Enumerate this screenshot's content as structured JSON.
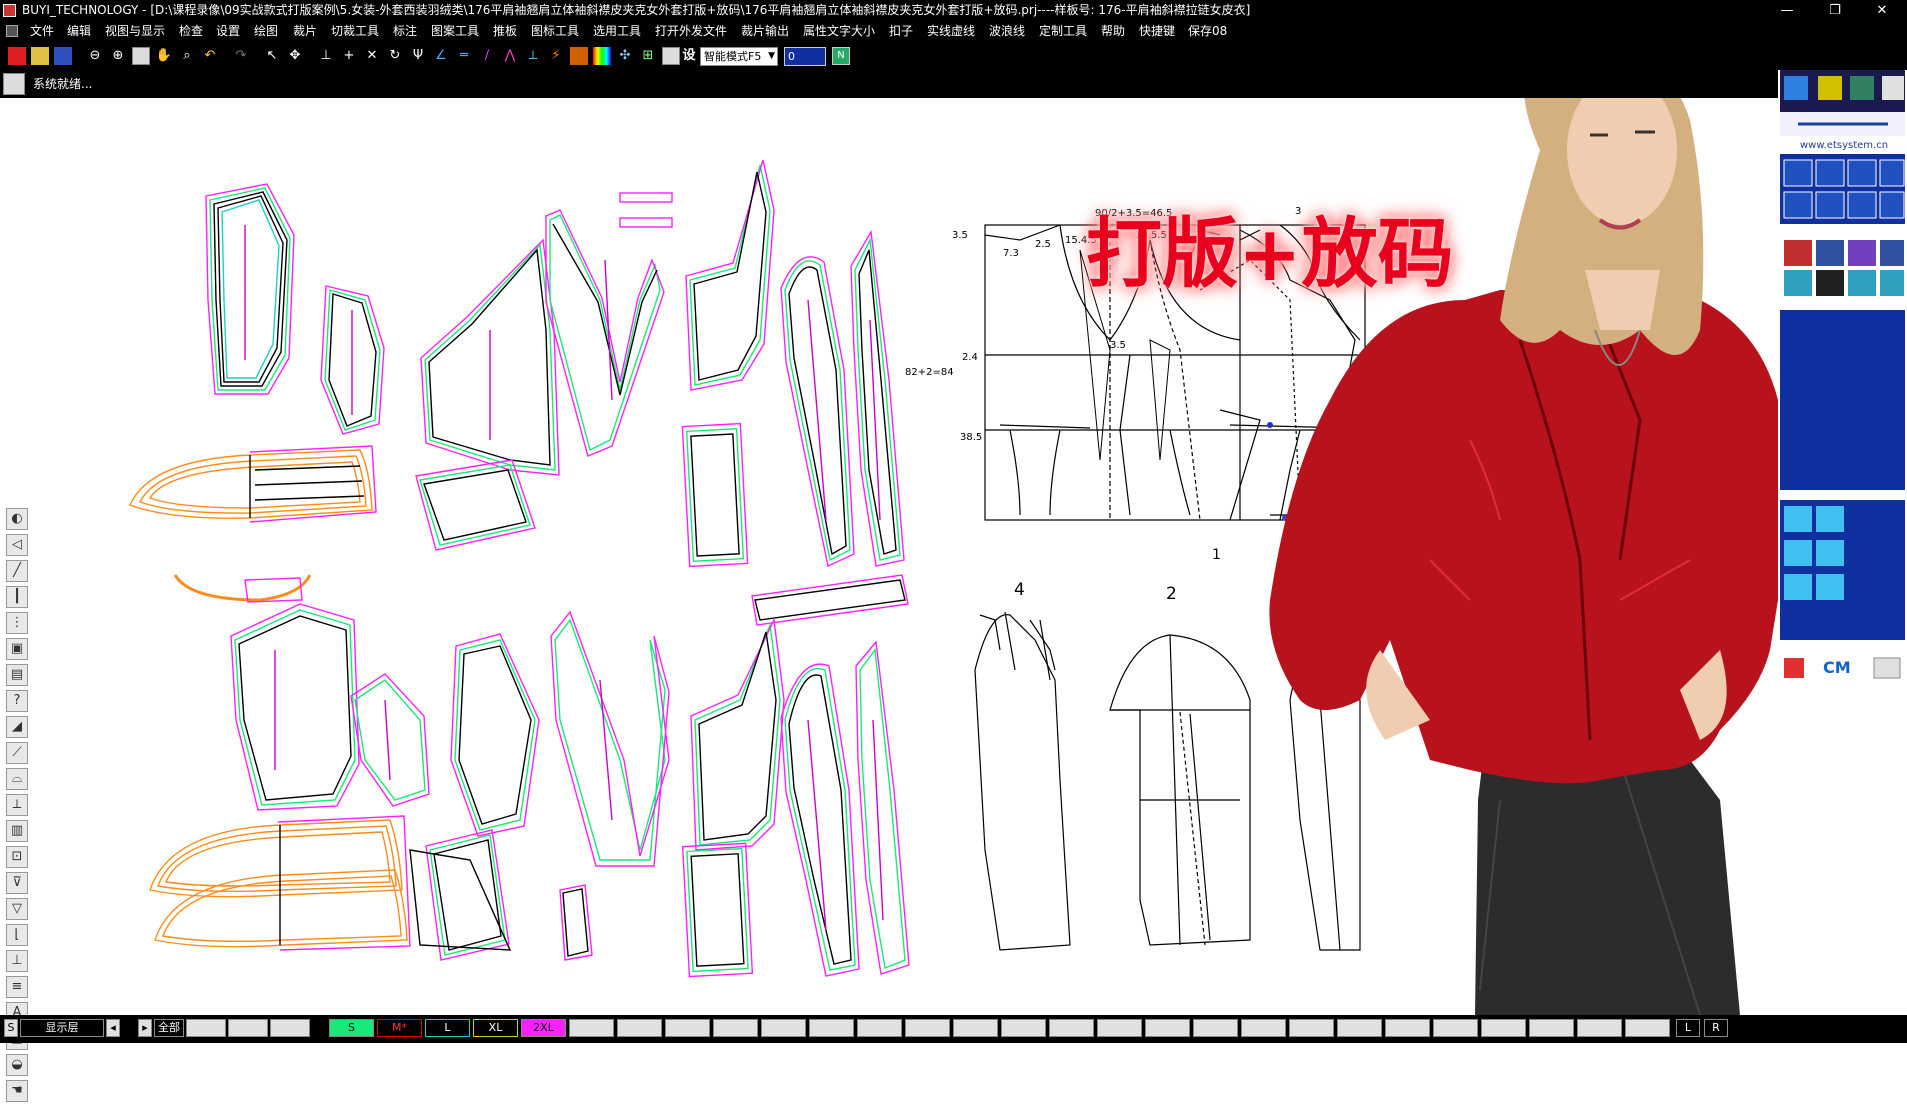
{
  "window": {
    "title": "BUYI_TECHNOLOGY - [D:\\课程录像\\09实战款式打版案例\\5.女装-外套西装羽绒类\\176平肩袖翘肩立体袖斜襟皮夹克女外套打版+放码\\176平肩袖翘肩立体袖斜襟皮夹克女外套打版+放码.prj----样板号: 176-平肩袖斜襟拉链女皮衣]",
    "minimize": "—",
    "restore": "❐",
    "close": "✕"
  },
  "menu": [
    "文件",
    "编辑",
    "视图与显示",
    "检查",
    "设置",
    "绘图",
    "裁片",
    "切裁工具",
    "标注",
    "图案工具",
    "推板",
    "图标工具",
    "选用工具",
    "打开外发文件",
    "裁片输出",
    "属性文字大小",
    "扣子",
    "实线虚线",
    "波浪线",
    "定制工具",
    "帮助",
    "快捷键",
    "保存08"
  ],
  "toolbar": {
    "mode_select": "智能模式F5",
    "numeric_value": "0",
    "settings_glyph": "设"
  },
  "status": {
    "text": "系统就绪..."
  },
  "overlay": {
    "headline": "打版+放码"
  },
  "draft": {
    "formula_top": "90/2+3.5=46.5",
    "formula_side": "82+2=84",
    "labels": [
      "3.5",
      "2.5",
      "7.3",
      "15.4.5",
      "16.5.5",
      "3",
      "2.4",
      "38.5",
      "3.5",
      "4",
      "2",
      "1"
    ]
  },
  "right_panel": {
    "site": "www.etsystem.cn",
    "unit": "CM"
  },
  "bottom": {
    "left_btn": "S",
    "layer_label": "显示层",
    "all_label": "全部",
    "sizes": [
      {
        "label": "S",
        "color": "#19e87a"
      },
      {
        "label": "M*",
        "color": "#d80000"
      },
      {
        "label": "L",
        "color": "#19d0c8"
      },
      {
        "label": "XL",
        "color": "#c8d000"
      },
      {
        "label": "2XL",
        "color": "#ff20ff"
      }
    ],
    "left_right": [
      "L",
      "R"
    ]
  },
  "colors": {
    "size_s": "#19e87a",
    "size_m": "#000000",
    "size_l": "#19d0c8",
    "size_xl": "#000000",
    "size_2xl": "#ff20ff",
    "grainline": "#cc00cc",
    "orange_piece": "#ff8c1a",
    "headline": "#e8001c"
  }
}
